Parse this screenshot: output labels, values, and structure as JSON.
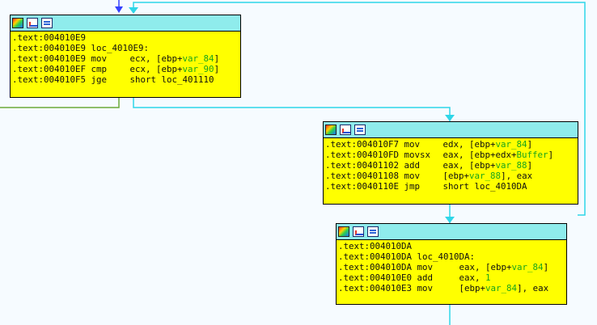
{
  "colors": {
    "node_background": "#ffff00",
    "node_header": "#8fecec",
    "edge_cyan": "#2fd6e8",
    "edge_green": "#6caa39",
    "edge_blue": "#3440ff",
    "background": "#f6fbff"
  },
  "nodes": [
    {
      "lines": [
        {
          "address": ".text:004010E9",
          "code": ""
        },
        {
          "address": ".text:004010E9",
          "code": "loc_4010E9:"
        },
        {
          "address": ".text:004010E9",
          "mnemonic": "mov",
          "operands": "ecx, [ebp+",
          "var": "var_84",
          "tail": "]"
        },
        {
          "address": ".text:004010EF",
          "mnemonic": "cmp",
          "operands": "ecx, [ebp+",
          "var": "var_90",
          "tail": "]"
        },
        {
          "address": ".text:004010F5",
          "mnemonic": "jge",
          "operands": "short loc_401110",
          "var": "",
          "tail": ""
        }
      ]
    },
    {
      "lines": [
        {
          "address": ".text:004010F7",
          "mnemonic": "mov",
          "operands": "edx, [ebp+",
          "var": "var_84",
          "tail": "]"
        },
        {
          "address": ".text:004010FD",
          "mnemonic": "movsx",
          "operands": "eax, [ebp+edx+",
          "var": "Buffer",
          "tail": "]"
        },
        {
          "address": ".text:00401102",
          "mnemonic": "add",
          "operands": "eax, [ebp+",
          "var": "var_88",
          "tail": "]"
        },
        {
          "address": ".text:00401108",
          "mnemonic": "mov",
          "operands": "[ebp+",
          "var": "var_88",
          "tail": "], eax"
        },
        {
          "address": ".text:0040110E",
          "mnemonic": "jmp",
          "operands": "short loc_4010DA",
          "var": "",
          "tail": ""
        }
      ]
    },
    {
      "lines": [
        {
          "address": ".text:004010DA",
          "code": ""
        },
        {
          "address": ".text:004010DA",
          "code": "loc_4010DA:"
        },
        {
          "address": ".text:004010DA",
          "mnemonic": "mov",
          "operands": "eax, [ebp+",
          "var": "var_84",
          "tail": "]"
        },
        {
          "address": ".text:004010E0",
          "mnemonic": "add",
          "operands": "eax, ",
          "var": "1",
          "tail": ""
        },
        {
          "address": ".text:004010E3",
          "mnemonic": "mov",
          "operands": "[ebp+",
          "var": "var_84",
          "tail": "], eax"
        }
      ]
    }
  ]
}
